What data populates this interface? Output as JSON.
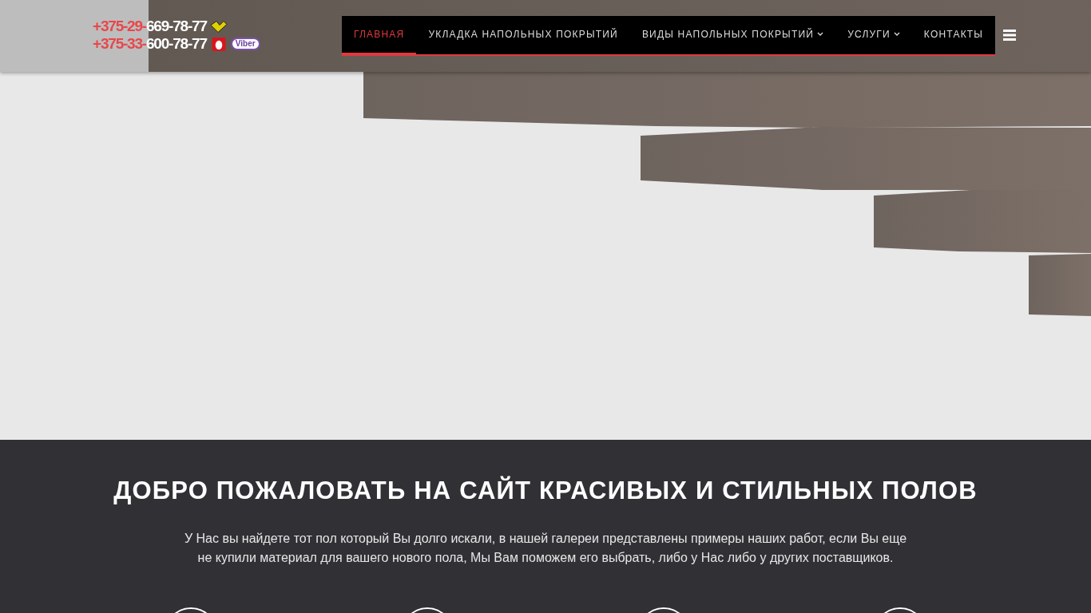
{
  "header": {
    "phones": [
      {
        "code": "+375-29-",
        "number": "669-78-77",
        "kind": "velcom",
        "viber": false
      },
      {
        "code": "+375-33-",
        "number": "600-78-77",
        "kind": "mts",
        "viber": true
      }
    ],
    "viber_label": "Viber"
  },
  "nav": {
    "items": [
      {
        "label": "ГЛАВНАЯ",
        "selected": true,
        "dropdown": false
      },
      {
        "label": "УКЛАДКА НАПОЛЬНЫХ ПОКРЫТИЙ",
        "selected": false,
        "dropdown": false
      },
      {
        "label": "ВИДЫ НАПОЛЬНЫХ ПОКРЫТИЙ",
        "selected": false,
        "dropdown": true
      },
      {
        "label": "УСЛУГИ",
        "selected": false,
        "dropdown": true
      },
      {
        "label": "КОНТАКТЫ",
        "selected": false,
        "dropdown": false
      }
    ]
  },
  "welcome": {
    "title": "ДОБРО ПОЖАЛОВАТЬ НА САЙТ КРАСИВЫХ И СТИЛЬНЫХ ПОЛОВ",
    "text": "У Нас вы найдете тот пол который Вы долго искали, в нашей галереи представлены примеры наших работ, если Вы еще не купили материал для вашего нового пола, Мы Вам поможем его выбрать, либо у Нас либо у других поставщиков."
  }
}
